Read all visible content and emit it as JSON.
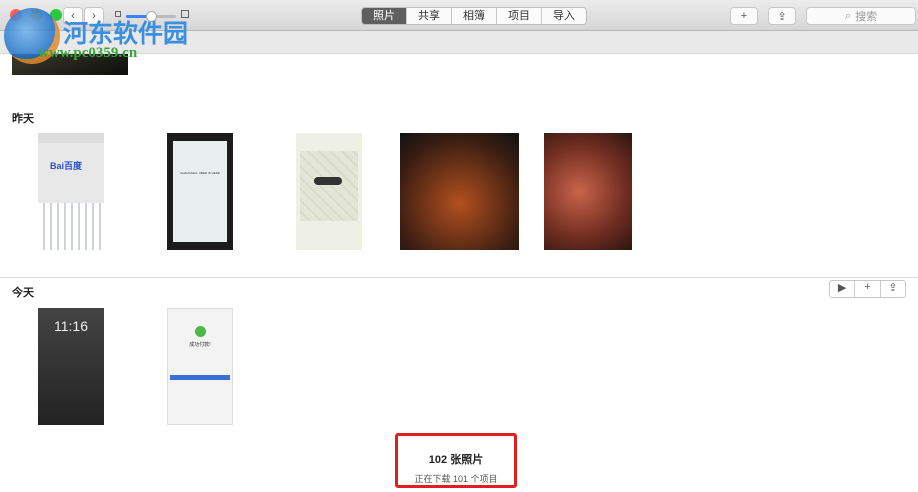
{
  "toolbar": {
    "tabs": [
      {
        "label": "照片",
        "active": true
      },
      {
        "label": "共享"
      },
      {
        "label": "相簿"
      },
      {
        "label": "项目"
      },
      {
        "label": "导入"
      }
    ],
    "add_label": "+",
    "search_placeholder": "搜索",
    "back_icon": "chevron-left-icon",
    "forward_icon": "chevron-right-icon",
    "zoom_slider_value": 0.5
  },
  "sections": [
    {
      "title": "昨天"
    },
    {
      "title": "今天"
    }
  ],
  "thumbs": {
    "baidu": "Bai百度",
    "lock_time": "11:16",
    "paid": "成功付款!",
    "uber": "CHANGSHA, UBER IS HERE"
  },
  "status": {
    "count": "102 张照片",
    "detail": "正在下载 101 个项目"
  },
  "watermark": {
    "name": "河东软件园",
    "url": "www.pc0359.cn"
  },
  "colors": {
    "highlight": "#e02020",
    "accent": "#3b82f6"
  }
}
